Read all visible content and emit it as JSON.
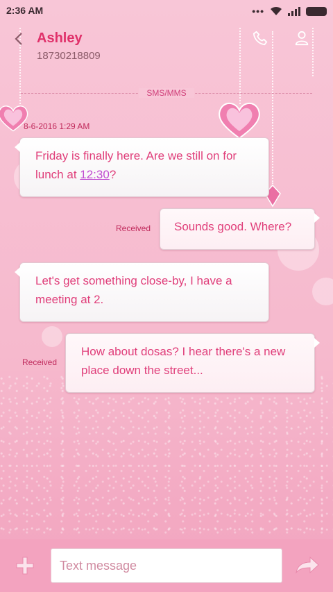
{
  "status_bar": {
    "time": "2:36 AM",
    "more": "•••"
  },
  "header": {
    "name": "Ashley",
    "number": "18730218809"
  },
  "divider": {
    "label": "SMS/MMS"
  },
  "thread": {
    "timestamp": "8-6-2016 1:29 AM",
    "messages": [
      {
        "text_before": "Friday is finally here. Are we still on for lunch at ",
        "link": "12:30",
        "text_after": "?"
      },
      {
        "label": "Received",
        "text": "Sounds good. Where?"
      },
      {
        "text": "Let's get something close-by, I have a meeting at 2."
      },
      {
        "label": "Received",
        "text": "How about dosas? I hear there's a new place down the street..."
      }
    ]
  },
  "composer": {
    "placeholder": "Text message"
  },
  "colors": {
    "accent": "#e0306a",
    "bubble_text": "#e03e7a",
    "bar": "#f3a3bf"
  },
  "icons": [
    "back-icon",
    "call-icon",
    "person-icon",
    "plus-icon",
    "send-icon",
    "wifi-icon",
    "signal-icon",
    "battery-icon"
  ]
}
